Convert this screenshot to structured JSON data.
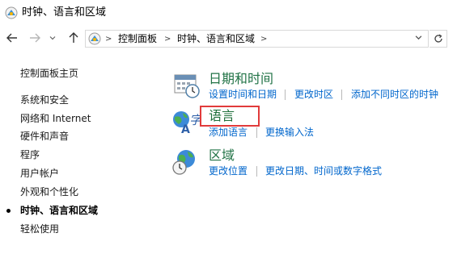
{
  "window": {
    "title": "时钟、语言和区域",
    "icon": "control-panel-icon"
  },
  "nav": {
    "back_icon": "back-arrow-icon",
    "forward_icon": "forward-arrow-icon",
    "recent_icon": "chevron-down-icon",
    "up_icon": "up-arrow-icon",
    "breadcrumbs": [
      "控制面板",
      "时钟、语言和区域"
    ],
    "refresh_icon": "refresh-icon"
  },
  "sidebar": {
    "home": "控制面板主页",
    "items": [
      {
        "label": "系统和安全",
        "current": false
      },
      {
        "label": "网络和 Internet",
        "current": false
      },
      {
        "label": "硬件和声音",
        "current": false
      },
      {
        "label": "程序",
        "current": false
      },
      {
        "label": "用户帐户",
        "current": false
      },
      {
        "label": "外观和个性化",
        "current": false
      },
      {
        "label": "时钟、语言和区域",
        "current": true
      },
      {
        "label": "轻松使用",
        "current": false
      }
    ]
  },
  "categories": [
    {
      "title": "日期和时间",
      "icon": "calendar-clock-icon",
      "links": [
        "设置时间和日期",
        "更改时区",
        "添加不同时区的时钟"
      ]
    },
    {
      "title": "语言",
      "icon": "language-globe-icon",
      "highlighted": true,
      "links": [
        "添加语言",
        "更换输入法"
      ]
    },
    {
      "title": "区域",
      "icon": "region-globe-clock-icon",
      "links": [
        "更改位置",
        "更改日期、时间或数字格式"
      ]
    }
  ],
  "colors": {
    "category_title": "#217346",
    "link": "#0066cc",
    "highlight_border": "#e13b3b"
  }
}
